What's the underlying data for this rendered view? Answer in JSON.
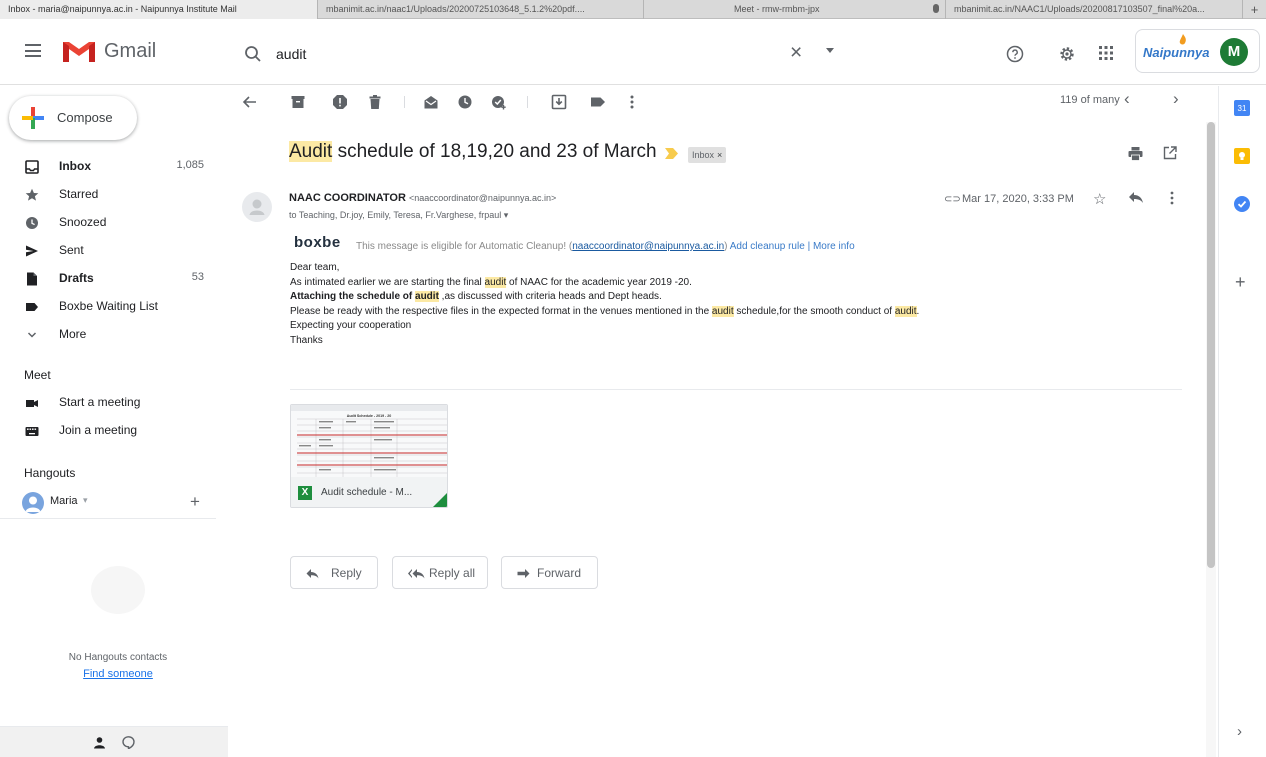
{
  "browser_tabs": [
    {
      "title": "Inbox - maria@naipunnya.ac.in - Naipunnya Institute Mail",
      "active": true
    },
    {
      "title": "mbanimit.ac.in/naac1/Uploads/20200725103648_5.1.2%20pdf....",
      "active": false
    },
    {
      "title": "Meet - rmw-rmbm-jpx",
      "active": false
    },
    {
      "title": "mbanimit.ac.in/NAAC1/Uploads/20200817103507_final%20a...",
      "active": false
    }
  ],
  "header": {
    "app_name": "Gmail",
    "search_value": "audit",
    "org_name": "Naipunnya",
    "avatar_letter": "M"
  },
  "sidebar": {
    "compose_label": "Compose",
    "items": [
      {
        "label": "Inbox",
        "count": "1,085",
        "icon": "inbox-icon"
      },
      {
        "label": "Starred",
        "count": "",
        "icon": "star-icon"
      },
      {
        "label": "Snoozed",
        "count": "",
        "icon": "clock-icon"
      },
      {
        "label": "Sent",
        "count": "",
        "icon": "send-icon"
      },
      {
        "label": "Drafts",
        "count": "53",
        "icon": "draft-icon"
      },
      {
        "label": "Boxbe Waiting List",
        "count": "",
        "icon": "label-icon"
      },
      {
        "label": "More",
        "count": "",
        "icon": "chevron-down-icon"
      }
    ],
    "meet_title": "Meet",
    "meet_items": [
      {
        "label": "Start a meeting",
        "icon": "video-icon"
      },
      {
        "label": "Join a meeting",
        "icon": "keyboard-icon"
      }
    ],
    "hangouts_title": "Hangouts",
    "hangouts_user": "Maria",
    "no_contacts": "No Hangouts contacts",
    "find_someone": "Find someone"
  },
  "toolbar": {
    "pager": "119 of many"
  },
  "message": {
    "subject_highlight": "Audit",
    "subject_rest": " schedule of 18,19,20 and 23 of March",
    "label_chip": "Inbox",
    "label_chip_close": "×",
    "sender_name": "NAAC COORDINATOR",
    "sender_email": "<naaccoordinator@naipunnya.ac.in>",
    "recipients": "to Teaching, Dr.joy, Emily, Teresa, Fr.Varghese, frpaul",
    "date": "Mar 17, 2020, 3:33 PM",
    "boxbe": {
      "logo": "boxbe",
      "text_before": "This message is eligible for Automatic Cleanup! (",
      "link_email": "naaccoordinator@naipunnya.ac.in",
      "text_after": ")",
      "add_rule": "Add cleanup rule",
      "separator": "|",
      "more_info": "More info"
    },
    "body": {
      "greeting": "Dear team,",
      "line1_a": "As intimated earlier we are starting the final ",
      "line1_hl": "audit",
      "line1_b": " of NAAC for the academic year 2019 -20.",
      "line2_bold": "Attaching the schedule of ",
      "line2_hl": "audit",
      "line2_rest": " ,as discussed with criteria heads and Dept heads.",
      "line3_a": "Please be ready with the respective files in the expected format in the venues mentioned in the ",
      "line3_hl": "audit",
      "line3_b": " schedule,for the smooth conduct of ",
      "line3_hl2": "audit",
      "line3_c": ".",
      "line4": "Expecting your cooperation",
      "line5": "Thanks"
    },
    "attachment": {
      "name": "Audit schedule - M...",
      "type_letter": "X",
      "preview_title": "Audit Schedule - 2019 - 20"
    },
    "actions": [
      "Reply",
      "Reply all",
      "Forward"
    ]
  },
  "right_panel": {
    "calendar_label": "31"
  }
}
